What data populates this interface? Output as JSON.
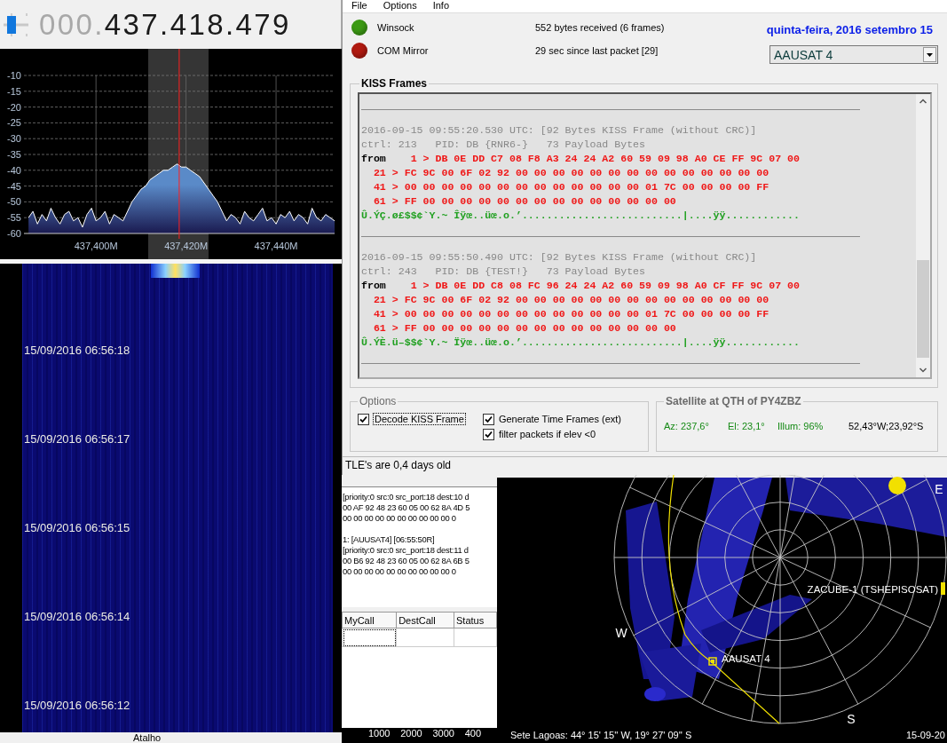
{
  "sdr": {
    "frequency_leading": "000.",
    "frequency": "437.418.479",
    "spectrum": {
      "chart_data": {
        "type": "line",
        "grid": true,
        "bands": [
          {
            "axis": "x",
            "from": 437411.6,
            "to": 437425,
            "color": "#353535"
          }
        ],
        "ref_lines": [
          {
            "axis": "x",
            "value": 437418.479,
            "color": "#ff2020"
          }
        ],
        "xlim": [
          437384,
          437453
        ],
        "ylim": [
          -60,
          -10
        ],
        "yticks": [
          -10,
          -15,
          -20,
          -25,
          -30,
          -35,
          -40,
          -45,
          -50,
          -55,
          -60
        ],
        "xticks": [
          {
            "value": 437400,
            "label": "437,400M"
          },
          {
            "value": 437420,
            "label": "437,420M"
          },
          {
            "value": 437440,
            "label": "437,440M"
          }
        ],
        "x": [
          437385,
          437386,
          437387,
          437388,
          437389,
          437390,
          437391,
          437392,
          437393,
          437394,
          437395,
          437396,
          437397,
          437398,
          437399,
          437400,
          437401,
          437402,
          437403,
          437404,
          437405,
          437406,
          437407,
          437408,
          437409,
          437410,
          437411,
          437412,
          437413,
          437414,
          437415,
          437416,
          437417,
          437418,
          437419,
          437420,
          437421,
          437422,
          437423,
          437424,
          437425,
          437426,
          437427,
          437428,
          437429,
          437430,
          437431,
          437432,
          437433,
          437434,
          437435,
          437436,
          437437,
          437438,
          437439,
          437440,
          437441,
          437442,
          437443,
          437444,
          437445,
          437446,
          437447,
          437448,
          437449,
          437450,
          437451,
          437452,
          437453
        ],
        "series": [
          {
            "color": "#ffffff",
            "values": [
              -55,
              -53,
              -57,
              -54,
              -56,
              -52,
              -55,
              -57,
              -54,
              -53,
              -56,
              -55,
              -58,
              -54,
              -52,
              -56,
              -55,
              -53,
              -57,
              -54,
              -55,
              -56,
              -53,
              -50,
              -48,
              -46,
              -45,
              -43,
              -42,
              -41,
              -40,
              -40,
              -39,
              -38,
              -39,
              -39,
              -40,
              -41,
              -42,
              -44,
              -46,
              -48,
              -50,
              -53,
              -56,
              -54,
              -55,
              -57,
              -53,
              -55,
              -56,
              -54,
              -52,
              -56,
              -55,
              -57,
              -54,
              -55,
              -53,
              -56,
              -54,
              -55,
              -57,
              -52,
              -55,
              -56,
              -54,
              -55,
              -56
            ]
          }
        ]
      }
    },
    "waterfall": {
      "timestamps": [
        "15/09/2016 06:56:18",
        "15/09/2016 06:56:17",
        "15/09/2016 06:56:15",
        "15/09/2016 06:56:14",
        "15/09/2016 06:56:12"
      ]
    },
    "bottom_label": "Atalho"
  },
  "decoder": {
    "menu": [
      "File",
      "Options",
      "Info"
    ],
    "connections": [
      {
        "name": "Winsock",
        "color": "#3c9a14",
        "status": "552 bytes received (6 frames)"
      },
      {
        "name": "COM Mirror",
        "color": "#b01a10",
        "status": "29 sec since last packet [29]"
      }
    ],
    "date": "quinta-feira, 2016 setembro 15",
    "satellite_select": "AAUSAT 4",
    "kiss_frames": {
      "title": "KISS Frames",
      "frames": [
        {
          "header": "2016-09-15 09:55:20.530 UTC: [92 Bytes KISS Frame (without CRC)]",
          "ctrl": "ctrl: 213   PID: DB {RNR6-}   73 Payload Bytes",
          "rows": [
            {
              "label": "from",
              "text": "1 > DB 0E DD C7 08 F8 A3 24 24 A2 60 59 09 98 A0 CE FF 9C 07 00"
            },
            {
              "text": "21 > FC 9C 00 6F 02 92 00 00 00 00 00 00 00 00 00 00 00 00 00 00"
            },
            {
              "text": "41 > 00 00 00 00 00 00 00 00 00 00 00 00 00 01 7C 00 00 00 00 FF"
            },
            {
              "text": "61 > FF 00 00 00 00 00 00 00 00 00 00 00 00 00 00"
            }
          ],
          "ascii": "Û.ÝÇ.ø£$$¢`Y.~ Îÿœ..üœ.o.’..........................|....ÿÿ............"
        },
        {
          "header": "2016-09-15 09:55:50.490 UTC: [92 Bytes KISS Frame (without CRC)]",
          "ctrl": "ctrl: 243   PID: DB {TEST!}   73 Payload Bytes",
          "rows": [
            {
              "label": "from",
              "text": "1 > DB 0E DD C8 08 FC 96 24 24 A2 60 59 09 98 A0 CF FF 9C 07 00"
            },
            {
              "text": "21 > FC 9C 00 6F 02 92 00 00 00 00 00 00 00 00 00 00 00 00 00 00"
            },
            {
              "text": "41 > 00 00 00 00 00 00 00 00 00 00 00 00 00 01 7C 00 00 00 00 FF"
            },
            {
              "text": "61 > FF 00 00 00 00 00 00 00 00 00 00 00 00 00 00"
            }
          ],
          "ascii": "Û.ÝÈ.ü–$$¢`Y.~ Ïÿœ..üœ.o.’..........................|....ÿÿ............"
        }
      ]
    },
    "options": {
      "title": "Options",
      "checkboxes": [
        {
          "label": "Decode KISS Frame",
          "checked": true
        },
        {
          "label": "Generate Time Frames (ext)",
          "checked": true
        },
        {
          "label": "filter packets if elev <0",
          "checked": true
        }
      ]
    },
    "satellite": {
      "title": "Satellite at QTH of PY4ZBZ",
      "az": "Az: 237,6°",
      "el": "El: 23,1°",
      "illum": "Illum: 96%",
      "position": "52,43°W;23,92°S"
    },
    "status_bar": "TLE's are 0,4 days old"
  },
  "log": {
    "entries": [
      [
        "[priority:0 src:0 src_port:18 dest:10 d",
        "00 AF 92 48 23 60 05 00 62 8A 4D 5",
        "00 00 00 00 00 00 00 00 00 00 0"
      ],
      [
        "1: [AUUSAT4] [06:55:50R]",
        "[priority:0 src:0 src_port:18 dest:11 d",
        "00 B6 92 48 23 60 05 00 62 8A 6B 5",
        "00 00 00 00 00 00 00 00 00 00 0"
      ]
    ],
    "table": {
      "columns": [
        "MyCall",
        "DestCall",
        "Status"
      ]
    },
    "axis_ticks": [
      "1000",
      "2000",
      "3000",
      "400"
    ]
  },
  "sky_map": {
    "compass": [
      "E",
      "W",
      "S"
    ],
    "satellites": [
      {
        "name": "ZACUBE-1 (TSHEPISOSAT)"
      },
      {
        "name": "AAUSAT 4"
      }
    ],
    "location": "Sete Lagoas: 44° 15' 15'' W, 19° 27' 09'' S",
    "date": "15-09-20"
  }
}
